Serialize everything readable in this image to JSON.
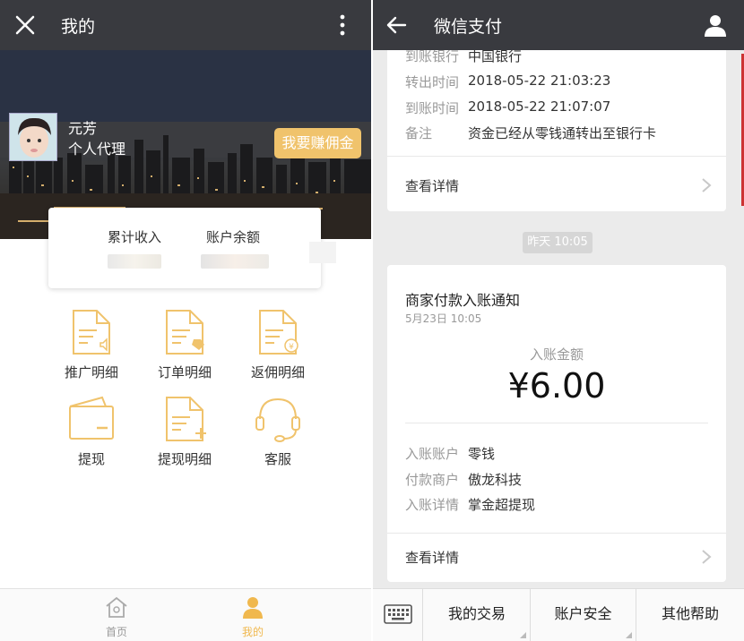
{
  "left": {
    "topbar": {
      "title": "我的",
      "close_icon": "close-icon",
      "more_icon": "more-vertical-icon"
    },
    "profile": {
      "name": "元芳",
      "role": "个人代理",
      "earn_button": "我要赚佣金"
    },
    "stats": {
      "total_income_label": "累计收入",
      "balance_label": "账户余额"
    },
    "menu": [
      {
        "label": "推广明细",
        "icon": "document-speaker-icon"
      },
      {
        "label": "订单明细",
        "icon": "document-tag-icon"
      },
      {
        "label": "返佣明细",
        "icon": "document-yen-icon"
      },
      {
        "label": "提现",
        "icon": "wallet-icon"
      },
      {
        "label": "提现明细",
        "icon": "document-plus-icon"
      },
      {
        "label": "客服",
        "icon": "headset-icon"
      }
    ],
    "nav": {
      "home": "首页",
      "mine": "我的"
    },
    "colors": {
      "accent": "#f0c36c",
      "topbar": "#393a3f"
    }
  },
  "right": {
    "topbar": {
      "title": "微信支付",
      "back_icon": "back-arrow-icon",
      "user_icon": "user-icon"
    },
    "card1": {
      "rows": [
        {
          "key": "到账银行",
          "value": "中国银行"
        },
        {
          "key": "转出时间",
          "value": "2018-05-22 21:03:23"
        },
        {
          "key": "到账时间",
          "value": "2018-05-22 21:07:07"
        },
        {
          "key": "备注",
          "value": "资金已经从零钱通转出至银行卡"
        }
      ],
      "detail_link": "查看详情"
    },
    "time_badge": "昨天 10:05",
    "card2": {
      "title": "商家付款入账通知",
      "date": "5月23日  10:05",
      "amount_label": "入账金额",
      "amount": "¥6.00",
      "rows": [
        {
          "key": "入账账户",
          "value": "零钱"
        },
        {
          "key": "付款商户",
          "value": "傲龙科技"
        },
        {
          "key": "入账详情",
          "value": "掌金超提现"
        }
      ],
      "detail_link": "查看详情"
    },
    "bottom_tabs": [
      "我的交易",
      "账户安全",
      "其他帮助"
    ],
    "keyboard_icon": "keyboard-icon"
  }
}
